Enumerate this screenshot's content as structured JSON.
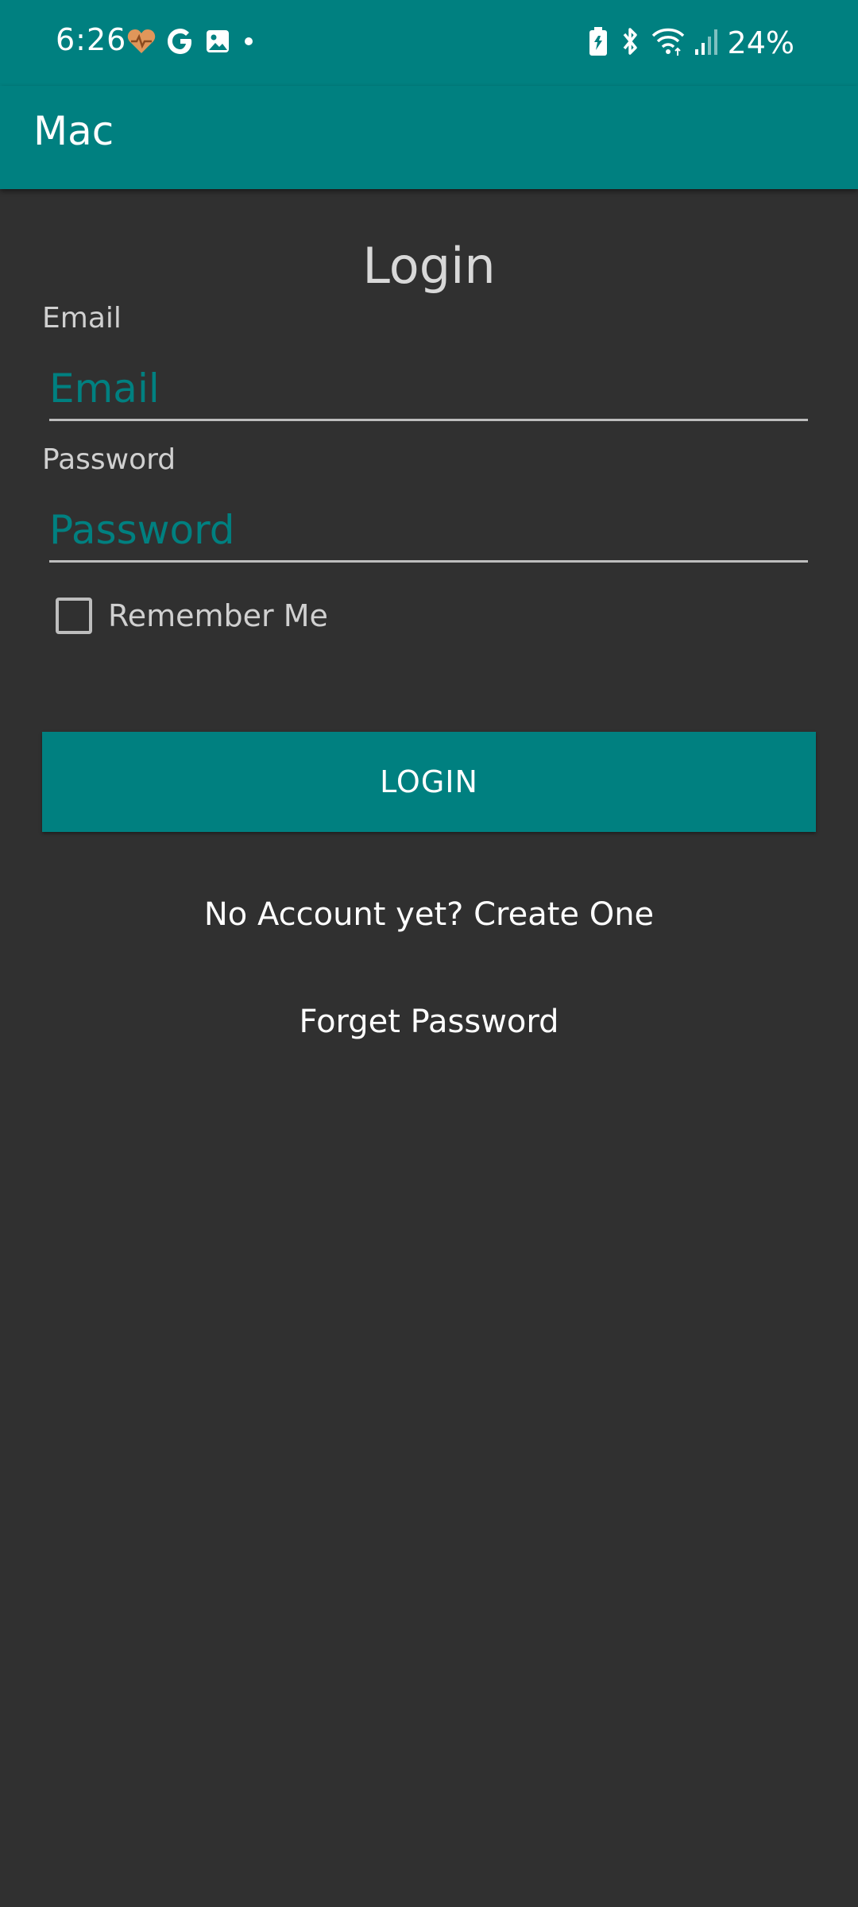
{
  "status_bar": {
    "time": "6:26",
    "battery_percent": "24%",
    "left_icons": [
      "health-heart-icon",
      "google-icon",
      "gallery-icon",
      "dot-icon"
    ],
    "right_icons": [
      "battery-saver-icon",
      "bluetooth-icon",
      "wifi-icon",
      "signal-icon"
    ]
  },
  "app_bar": {
    "title": "Mac"
  },
  "login_form": {
    "title": "Login",
    "email_label": "Email",
    "email_placeholder": "Email",
    "email_value": "",
    "password_label": "Password",
    "password_placeholder": "Password",
    "password_value": "",
    "remember_label": "Remember Me",
    "remember_checked": false,
    "login_button": "LOGIN",
    "create_account_link": "No Account yet? Create One",
    "forget_password_link": "Forget Password"
  },
  "colors": {
    "primary": "#008080",
    "background": "#303030",
    "text_primary": "#ffffff",
    "text_secondary": "#d0d0d0",
    "heart_accent": "#e0965a"
  }
}
